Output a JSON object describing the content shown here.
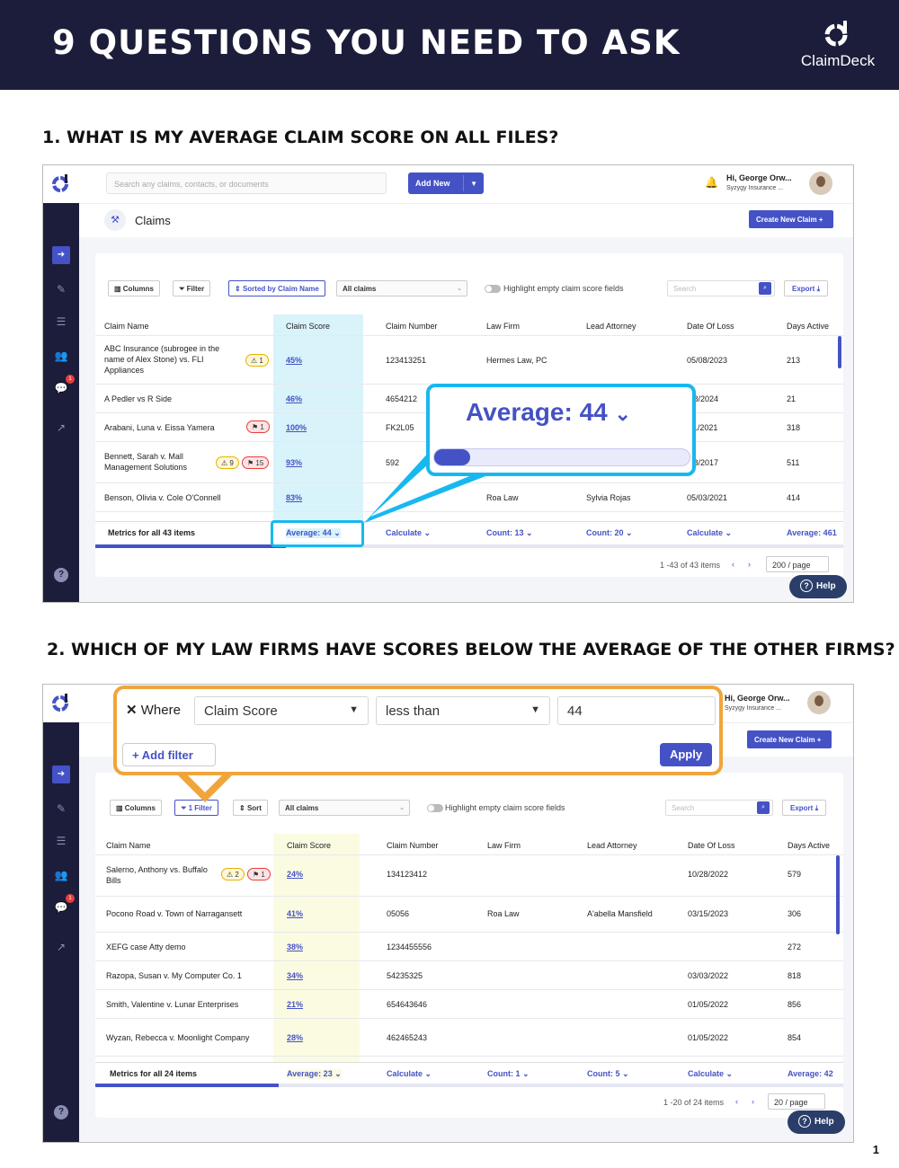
{
  "banner": {
    "title": "9 QUESTIONS YOU NEED TO ASK",
    "brand": "ClaimDeck"
  },
  "q1": {
    "title": "1. WHAT IS MY AVERAGE CLAIM SCORE ON ALL FILES?"
  },
  "q2": {
    "title": "2. WHICH OF MY LAW FIRMS HAVE SCORES BELOW THE AVERAGE OF THE OTHER FIRMS?"
  },
  "app": {
    "search_placeholder": "Search any claims, contacts, or documents",
    "add_new": "Add New",
    "user_name": "Hi, George  Orw...",
    "user_company": "Syzygy Insurance ...",
    "page_title": "Claims",
    "create_new_claim": "Create New Claim +",
    "table_search_placeholder": "Search",
    "export": "Export",
    "highlight_label": "Highlight empty claim score fields",
    "columns": [
      "Claim Name",
      "Claim Score",
      "Claim Number",
      "Law Firm",
      "Lead Attorney",
      "Date Of Loss",
      "Days Active"
    ],
    "help": "Help"
  },
  "shot1": {
    "toolbar": {
      "columns": "Columns",
      "filter": "Filter",
      "sorted": "Sorted by Claim Name",
      "select": "All claims"
    },
    "rows": [
      {
        "name": "ABC Insurance (subrogee in the name of Alex Stone) vs. FLI Appliances",
        "tag_y": "1",
        "tag_r": "",
        "score": "45%",
        "number": "123413251",
        "firm": "Hermes Law, PC",
        "attorney": "",
        "date": "05/08/2023",
        "days": "213"
      },
      {
        "name": "A Pedler vs R Side",
        "tag_y": "",
        "tag_r": "",
        "score": "46%",
        "number": "4654212",
        "firm": "",
        "attorney": "",
        "date": "/18/2024",
        "days": "21"
      },
      {
        "name": "Arabani, Luna v. Eissa Yamera",
        "tag_y": "",
        "tag_r": "1",
        "score": "100%",
        "number": "FK2L05",
        "firm": "",
        "attorney": "",
        "date": "/11/2021",
        "days": "318"
      },
      {
        "name": "Bennett, Sarah v. Mall Management Solutions",
        "tag_y": "9",
        "tag_r": "15",
        "score": "93%",
        "number": "592",
        "firm": "",
        "attorney": "",
        "date": "/18/2017",
        "days": "511"
      },
      {
        "name": "Benson, Olivia v. Cole O'Connell",
        "tag_y": "",
        "tag_r": "",
        "score": "83%",
        "number": "",
        "firm": "Roa Law",
        "attorney": "Sylvia Rojas",
        "date": "05/03/2021",
        "days": "414"
      }
    ],
    "metrics": {
      "label": "Metrics for all 43 items",
      "score": "Average: 44",
      "number": "Calculate",
      "firm": "Count: 13",
      "attorney": "Count: 20",
      "date": "Calculate",
      "days": "Average: 461"
    },
    "pager": {
      "text": "1 -43 of 43 items",
      "per_page": "200 / page"
    },
    "callout": {
      "text": "Average: 44",
      "progress": 0.14
    }
  },
  "shot2": {
    "toolbar": {
      "columns": "Columns",
      "filter": "1 Filter",
      "sort": "Sort",
      "select": "All claims"
    },
    "filter_popup": {
      "where": "Where",
      "field": "Claim Score",
      "operator": "less than",
      "value": "44",
      "add_filter": "Add filter",
      "apply": "Apply"
    },
    "rows": [
      {
        "name": "Salerno, Anthony vs. Buffalo Bills",
        "tag_y": "2",
        "tag_r": "1",
        "score": "24%",
        "number": "134123412",
        "firm": "",
        "attorney": "",
        "date": "10/28/2022",
        "days": "579"
      },
      {
        "name": "Pocono Road v. Town of Narragansett",
        "tag_y": "",
        "tag_r": "",
        "score": "41%",
        "number": "05056",
        "firm": "Roa Law",
        "attorney": "A'abella Mansfield",
        "date": "03/15/2023",
        "days": "306"
      },
      {
        "name": "XEFG case Atty demo",
        "tag_y": "",
        "tag_r": "",
        "score": "38%",
        "number": "1234455556",
        "firm": "",
        "attorney": "",
        "date": "",
        "days": "272"
      },
      {
        "name": "Razopa, Susan v. My Computer Co. 1",
        "tag_y": "",
        "tag_r": "",
        "score": "34%",
        "number": "54235325",
        "firm": "",
        "attorney": "",
        "date": "03/03/2022",
        "days": "818"
      },
      {
        "name": "Smith, Valentine v. Lunar Enterprises",
        "tag_y": "",
        "tag_r": "",
        "score": "21%",
        "number": "654643646",
        "firm": "",
        "attorney": "",
        "date": "01/05/2022",
        "days": "856"
      },
      {
        "name": "Wyzan, Rebecca v. Moonlight Company",
        "tag_y": "",
        "tag_r": "",
        "score": "28%",
        "number": "462465243",
        "firm": "",
        "attorney": "",
        "date": "01/05/2022",
        "days": "854"
      }
    ],
    "metrics": {
      "label": "Metrics for all 24 items",
      "score": "Average: 23",
      "number": "Calculate",
      "firm": "Count: 1",
      "attorney": "Count: 5",
      "date": "Calculate",
      "days": "Average: 42"
    },
    "pager": {
      "text": "1 -20 of 24 items",
      "per_page": "20 / page"
    }
  },
  "page_number": "1",
  "colors": {
    "navy": "#1c1d3a",
    "accent": "#4552c5",
    "callout_blue": "#18b8ef",
    "callout_orange": "#f0a53a",
    "score_col_1": "#d9f3fb",
    "score_col_2": "#fbfbe2"
  }
}
